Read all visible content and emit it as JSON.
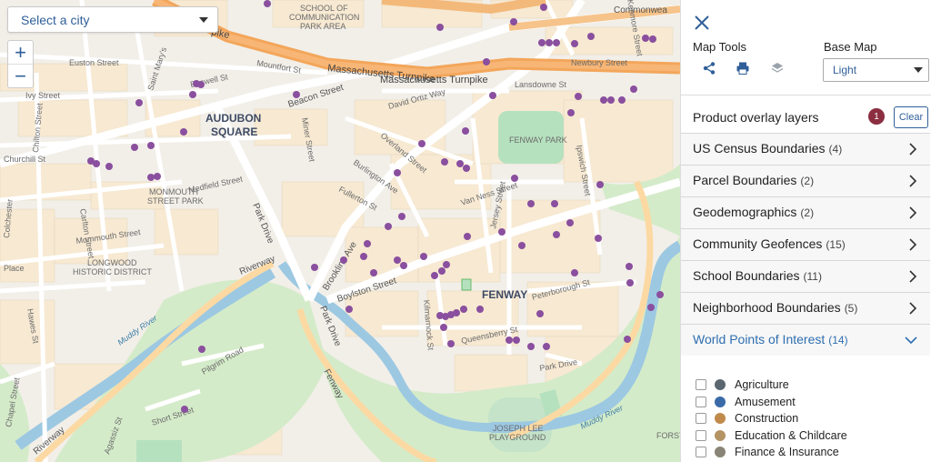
{
  "city_select": {
    "placeholder": "Select a city"
  },
  "zoom": {
    "in": "+",
    "out": "−"
  },
  "map": {
    "labels": {
      "audubon_1": "AUDUBON",
      "audubon_2": "SQUARE",
      "fenway": "FENWAY",
      "fenway_park": "FENWAY PARK",
      "monmouth_1": "MONMOUTH",
      "monmouth_2": "STREET PARK",
      "longwood_1": "LONGWOOD",
      "longwood_2": "HISTORIC DISTRICT",
      "joseph_lee_1": "JOSEPH LEE",
      "joseph_lee_2": "PLAYGROUND",
      "school_1": "SCHOOL OF",
      "school_2": "COMMUNICATION",
      "school_3": "PARK AREA",
      "mass_pike_1": "Massachusetts Turnpike",
      "mass_pike_2": "Massachusetts Turnpike",
      "pike": "pike",
      "commonwealth": "Commonwea",
      "beacon": "Beacon Street",
      "boylston": "Boylston Street",
      "brookline": "Brookline Ave",
      "park_drive_1": "Park Drive",
      "park_drive_2": "Park Drive",
      "riverway_1": "Riverway",
      "riverway_2": "Riverway",
      "fenway_road": "Fenway",
      "muddy_1": "Muddy River",
      "muddy_2": "Muddy River",
      "euston": "Euston Street",
      "mountfort": "Mountfort St",
      "ivy": "Ivy Street",
      "buswell": "Buswell St",
      "saint_marys": "Saint Mary's",
      "chilton": "Chilton Street",
      "churchill": "Churchill St",
      "carlton": "Carlton Street",
      "medfield": "Medfield Street",
      "mommouth": "Mommouth Street",
      "colchester": "Colchester",
      "hawes": "Hawes St",
      "place": "Place",
      "david_ortiz": "David Ortiz Way",
      "overland": "Overland Street",
      "burlington": "Burlington Ave",
      "fullerton": "Fullerton St",
      "miner": "Miner Street",
      "van_ness": "Van Ness Street",
      "lansdowne": "Lansdowne St",
      "newbury": "Newbury Street",
      "kenmore": "Kenmore Street",
      "ipswich": "Ipswich Street",
      "jersey": "Jersey Street",
      "peterborough": "Peterborough St",
      "kilmarnock": "Kilmarnock St",
      "queensberry": "Queensberry St",
      "park_drive_3": "Park Drive",
      "pilgrim": "Pilgrim Road",
      "short_st": "Short Street",
      "chapel": "Chapel Street",
      "forsy": "FORSY",
      "agassiz": "Agassiz St"
    }
  },
  "panel": {
    "map_tools_label": "Map Tools",
    "base_map_label": "Base Map",
    "base_map_value": "Light",
    "overlay_header": "Product overlay layers",
    "overlay_count": "1",
    "clear_label": "Clear",
    "layers": [
      {
        "name": "US Census Boundaries",
        "count": "(4)"
      },
      {
        "name": "Parcel Boundaries",
        "count": "(2)"
      },
      {
        "name": "Geodemographics",
        "count": "(2)"
      },
      {
        "name": "Community Geofences",
        "count": "(15)"
      },
      {
        "name": "School Boundaries",
        "count": "(11)"
      },
      {
        "name": "Neighborhood Boundaries",
        "count": "(5)"
      },
      {
        "name": "World Points of Interest",
        "count": "(14)"
      }
    ],
    "poi_items": [
      {
        "label": "Agriculture",
        "color": "#5b6770"
      },
      {
        "label": "Amusement",
        "color": "#3a6aa8"
      },
      {
        "label": "Construction",
        "color": "#c08a4a"
      },
      {
        "label": "Education & Childcare",
        "color": "#b49464"
      },
      {
        "label": "Finance & Insurance",
        "color": "#8a8476"
      }
    ]
  },
  "colors": {
    "poi_dot": "#8a4f9e",
    "accent": "#2f6fb0",
    "badge": "#8b2e3f"
  }
}
